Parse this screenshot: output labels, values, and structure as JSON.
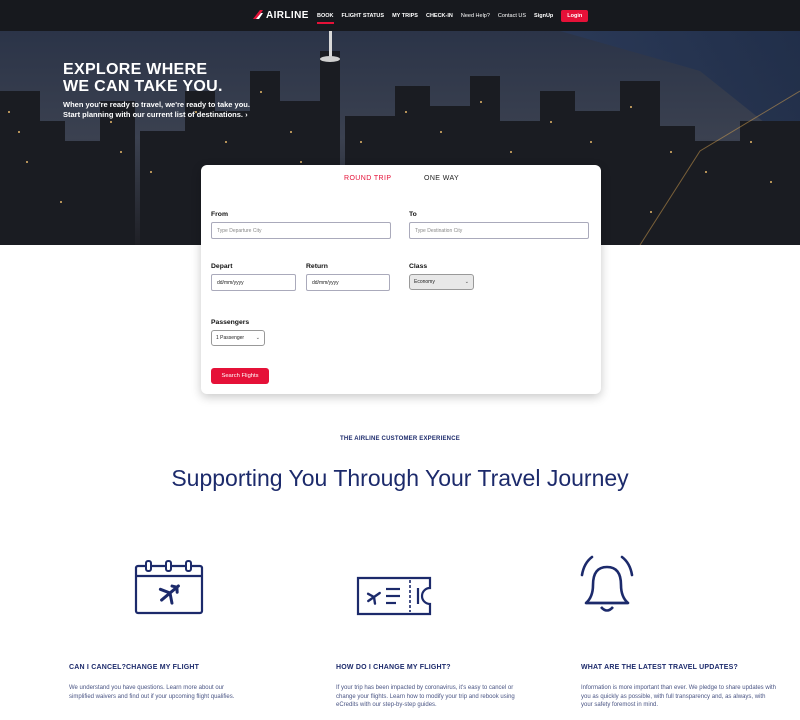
{
  "nav": {
    "logo": "AIRLINE",
    "links": [
      {
        "label": "BOOK",
        "active": true
      },
      {
        "label": "FLIGHT STATUS"
      },
      {
        "label": "MY TRIPS"
      },
      {
        "label": "CHECK-IN"
      },
      {
        "label": "Need Help?"
      },
      {
        "label": "Contact US"
      },
      {
        "label": "SignUp"
      }
    ],
    "login_label": "Login"
  },
  "hero": {
    "title_line1": "EXPLORE WHERE",
    "title_line2": "WE CAN TAKE YOU.",
    "subtitle": "When you're ready to travel, we're ready to take you. Start planning with our current list of destinations. ›"
  },
  "booking": {
    "tabs": {
      "round_trip": "ROUND TRIP",
      "one_way": "ONE WAY"
    },
    "from": {
      "label": "From",
      "placeholder": "Type Departure City"
    },
    "to": {
      "label": "To",
      "placeholder": "Type Destination City"
    },
    "depart": {
      "label": "Depart",
      "value": "dd/mm/yyyy"
    },
    "return": {
      "label": "Return",
      "value": "dd/mm/yyyy"
    },
    "class": {
      "label": "Class",
      "selected": "Economy"
    },
    "passengers": {
      "label": "Passengers",
      "selected": "1 Passenger"
    },
    "search_label": "Search Flights"
  },
  "experience": {
    "eyebrow": "THE AIRLINE CUSTOMER EXPERIENCE",
    "headline": "Supporting You Through Your Travel Journey",
    "features": [
      {
        "icon": "calendar-plane-icon",
        "title": "CAN I CANCEL?CHANGE MY FLIGHT",
        "text": "We understand you have questions. Learn more about our simplified waivers and find out if your upcoming flight qualifies."
      },
      {
        "icon": "ticket-icon",
        "title": "HOW DO I CHANGE MY FLIGHT?",
        "text": "If your trip has been impacted by coronavirus, it's easy to cancel or change your flights. Learn how to modify your trip and rebook using eCredits with our step-by-step guides."
      },
      {
        "icon": "bell-icon",
        "title": "WHAT ARE THE LATEST TRAVEL UPDATES?",
        "text": "Information is more important than ever. We pledge to share updates with you as quickly as possible, with full transparency and, as always, with your safety foremost in mind."
      }
    ]
  },
  "colors": {
    "accent": "#e51138",
    "navy": "#1c2a6b",
    "nav_bg": "#17191e"
  }
}
